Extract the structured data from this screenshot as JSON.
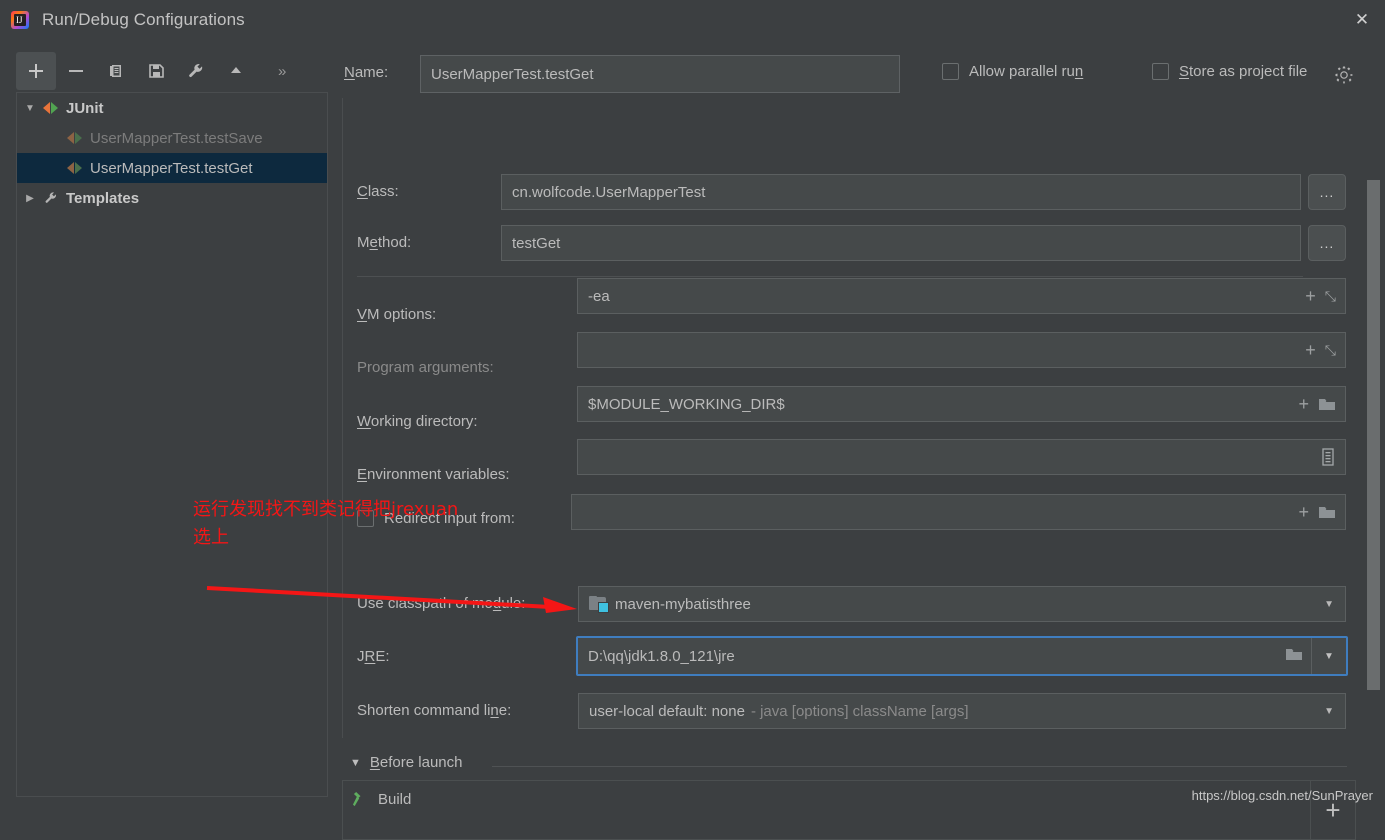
{
  "window": {
    "title": "Run/Debug Configurations",
    "app_icon": "intellij-idea-icon",
    "close_label": "✕"
  },
  "toolbar": {
    "add_label": "+",
    "remove_label": "−",
    "copy_label": "copy-icon",
    "save_label": "save-icon",
    "edit_templates_label": "wrench-icon",
    "move_up_label": "▲",
    "more_label": "»"
  },
  "tree": {
    "root": {
      "label": "JUnit",
      "twisty": "▼",
      "icon": "junit-icon"
    },
    "items": [
      {
        "label": "UserMapperTest.testSave",
        "icon": "junit-icon",
        "selected": false,
        "dim": true
      },
      {
        "label": "UserMapperTest.testGet",
        "icon": "junit-icon",
        "selected": true,
        "dim": false
      }
    ],
    "templates": {
      "label": "Templates",
      "twisty": "▶",
      "icon": "wrench-icon"
    }
  },
  "form": {
    "name": {
      "label": "Name:",
      "value": "UserMapperTest.testGet"
    },
    "allow_parallel_run": {
      "label": "Allow parallel run",
      "checked": false
    },
    "store_as_project_file": {
      "label": "Store as project file",
      "checked": false
    },
    "class": {
      "label": "Class:",
      "value": "cn.wolfcode.UserMapperTest",
      "browse": "..."
    },
    "method": {
      "label": "Method:",
      "value": "testGet",
      "browse": "..."
    },
    "vm_options": {
      "label": "VM options:",
      "value": "-ea"
    },
    "program_arguments": {
      "label": "Program arguments:",
      "value": ""
    },
    "working_directory": {
      "label": "Working directory:",
      "value": "$MODULE_WORKING_DIR$"
    },
    "environment_variables": {
      "label": "Environment variables:",
      "value": ""
    },
    "redirect_input": {
      "label": "Redirect input from:",
      "value": "",
      "checked": false
    },
    "use_classpath_of_module": {
      "label": "Use classpath of module:",
      "value": "maven-mybatisthree",
      "icon": "module-folder-icon",
      "caret": "▼"
    },
    "jre": {
      "label": "JRE:",
      "value": "D:\\qq\\jdk1.8.0_121\\jre",
      "focused": true,
      "caret": "▼",
      "browse_icon": "folder-icon"
    },
    "shorten_command_line": {
      "label": "Shorten command line:",
      "value": "user-local default: none",
      "hint": "- java [options] className [args]",
      "caret": "▼"
    }
  },
  "before_launch": {
    "title": "Before launch",
    "twisty": "▼",
    "items": [
      {
        "label": "Build",
        "icon": "build-hammer-icon"
      }
    ],
    "add_label": "+"
  },
  "annotations": {
    "note_line1": "运行发现找不到类记得把jrexuan",
    "note_line2": "选上",
    "arrow": "red-arrow-pointing-to-jre-field",
    "color": "#f41616"
  },
  "watermark": {
    "text": "https://blog.csdn.net/SunPrayer"
  },
  "colors": {
    "dialog_bg": "#3c3f41",
    "field_bg": "#45494a",
    "selection_bg": "#0d293e",
    "focus_border": "#3f7dbf",
    "text": "#bbbbbb",
    "annotation_red": "#f41616"
  }
}
